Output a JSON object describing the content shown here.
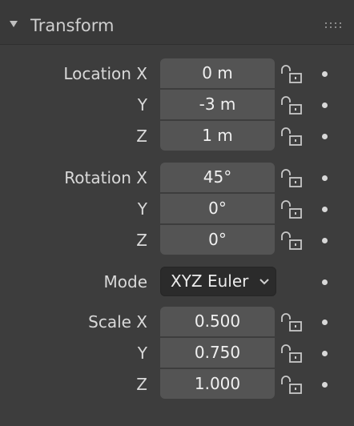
{
  "panel": {
    "title": "Transform"
  },
  "location": {
    "label": "Location X",
    "x_label": "Location X",
    "y_label": "Y",
    "z_label": "Z",
    "x": "0 m",
    "y": "-3 m",
    "z": "1 m"
  },
  "rotation": {
    "x_label": "Rotation X",
    "y_label": "Y",
    "z_label": "Z",
    "x": "45°",
    "y": "0°",
    "z": "0°"
  },
  "mode": {
    "label": "Mode",
    "selected": "XYZ Euler"
  },
  "scale": {
    "x_label": "Scale X",
    "y_label": "Y",
    "z_label": "Z",
    "x": "0.500",
    "y": "0.750",
    "z": "1.000"
  },
  "colors": {
    "panel_bg": "#3d3d3d",
    "header_bg": "#393939",
    "field_bg": "#545454",
    "dropdown_bg": "#2b2b2b",
    "text": "#e6e6e6"
  },
  "icons": {
    "collapse": "triangle-down-icon",
    "drag": "drag-handle-icon",
    "lock": "lock-open-icon",
    "keyframe": "dot-icon",
    "dropdown": "chevron-down-icon"
  }
}
